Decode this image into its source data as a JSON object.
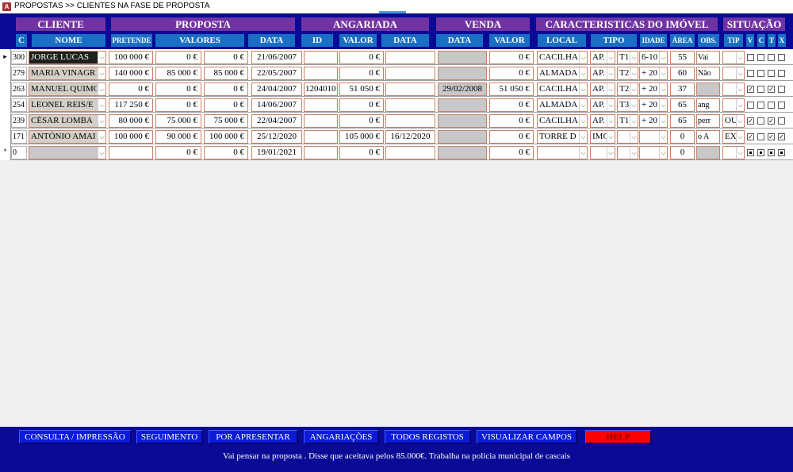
{
  "window": {
    "title": "PROPOSTAS >> CLIENTES NA FASE DE PROPOSTA",
    "icon": "access-icon"
  },
  "groups": {
    "cliente": "CLIENTE",
    "proposta": "PROPOSTA",
    "angariada": "ANGARIADA",
    "venda": "VENDA",
    "caracteristicas": "CARACTERISTICAS DO IMÓVEL",
    "situacao": "SITUAÇÃO"
  },
  "columns": {
    "c": "C",
    "nome": "NOME",
    "pretende": "PRETENDE",
    "valores": "VALORES",
    "data": "DATA",
    "ang_id": "ID",
    "ang_valor": "VALOR",
    "ang_data": "DATA",
    "venda_data": "DATA",
    "venda_valor": "VALOR",
    "local": "LOCAL",
    "tipo": "TIPO",
    "idade": "IDADE",
    "area": "ÁREA",
    "obs": "OBS.",
    "tip": "TIP",
    "v": "V",
    "cc": "C",
    "t": "T",
    "x": "X"
  },
  "rows": [
    {
      "sel": "▸",
      "c": "300",
      "nome": "JORGE LUCAS",
      "pretende": "100 000 €",
      "valor1": "0 €",
      "valor2": "0 €",
      "data": "21/06/2007",
      "ang_id": "",
      "ang_valor": "0 €",
      "ang_data": "",
      "venda_data": "",
      "venda_valor": "0 €",
      "local": "CACILHA",
      "tipo": "AP.",
      "tipo2": "T1",
      "idade": "6-10",
      "area": "55",
      "obs": "Vai",
      "tip": "",
      "v": false,
      "cc": false,
      "t": false,
      "x": false
    },
    {
      "sel": "",
      "c": "279",
      "nome": "MARIA VINAGR",
      "pretende": "140 000 €",
      "valor1": "85 000 €",
      "valor2": "85 000 €",
      "data": "22/05/2007",
      "ang_id": "",
      "ang_valor": "0 €",
      "ang_data": "",
      "venda_data": "",
      "venda_valor": "0 €",
      "local": "ALMADA",
      "tipo": "AP.",
      "tipo2": "T2",
      "idade": "+ 20",
      "area": "60",
      "obs": "Não",
      "tip": "",
      "v": false,
      "cc": false,
      "t": false,
      "x": false
    },
    {
      "sel": "",
      "c": "263",
      "nome": "MANUEL QUIMC",
      "pretende": "0 €",
      "valor1": "0 €",
      "valor2": "0 €",
      "data": "24/04/2007",
      "ang_id": "1204010",
      "ang_valor": "51 050 €",
      "ang_data": "",
      "venda_data": "29/02/2008",
      "venda_valor": "51 050 €",
      "local": "CACILHA",
      "tipo": "AP.",
      "tipo2": "T2",
      "idade": "+ 20",
      "area": "37",
      "obs": "",
      "tip": "",
      "v": true,
      "cc": false,
      "t": true,
      "x": false
    },
    {
      "sel": "",
      "c": "254",
      "nome": "LEONEL REIS/E",
      "pretende": "117 250 €",
      "valor1": "0 €",
      "valor2": "0 €",
      "data": "14/06/2007",
      "ang_id": "",
      "ang_valor": "0 €",
      "ang_data": "",
      "venda_data": "",
      "venda_valor": "0 €",
      "local": "ALMADA",
      "tipo": "AP.",
      "tipo2": "T3",
      "idade": "+ 20",
      "area": "65",
      "obs": "ang",
      "tip": "",
      "v": false,
      "cc": false,
      "t": false,
      "x": false
    },
    {
      "sel": "",
      "c": "239",
      "nome": "CÉSAR LOMBA",
      "pretende": "80 000 €",
      "valor1": "75 000 €",
      "valor2": "75 000 €",
      "data": "22/04/2007",
      "ang_id": "",
      "ang_valor": "0 €",
      "ang_data": "",
      "venda_data": "",
      "venda_valor": "0 €",
      "local": "CACILHA",
      "tipo": "AP.",
      "tipo2": "T1",
      "idade": "+ 20",
      "area": "65",
      "obs": "perr",
      "tip": "OU",
      "v": true,
      "cc": false,
      "t": true,
      "x": false
    },
    {
      "sel": "",
      "c": "171",
      "nome": "ANTÓNIO AMAI",
      "pretende": "100 000 €",
      "valor1": "90 000 €",
      "valor2": "100 000 €",
      "data": "25/12/2020",
      "ang_id": "",
      "ang_valor": "105 000 €",
      "ang_data": "16/12/2020",
      "venda_data": "",
      "venda_valor": "0 €",
      "local": "TORRE D",
      "tipo": "IMC",
      "tipo2": "",
      "idade": "",
      "area": "0",
      "obs": "o A",
      "tip": "EX",
      "v": true,
      "cc": false,
      "t": true,
      "x": true
    },
    {
      "sel": "*",
      "c": "0",
      "nome": "",
      "pretende": "",
      "valor1": "0 €",
      "valor2": "0 €",
      "data": "19/01/2021",
      "ang_id": "",
      "ang_valor": "0 €",
      "ang_data": "",
      "venda_data": "",
      "venda_valor": "0 €",
      "local": "",
      "tipo": "",
      "tipo2": "",
      "idade": "",
      "area": "0",
      "obs": "",
      "tip": "",
      "v": "new",
      "cc": "new",
      "t": "new",
      "x": "new"
    }
  ],
  "footer": {
    "buttons": {
      "consulta": "CONSULTA / IMPRESSÃO",
      "seguimento": "SEGUIMENTO",
      "por_apresentar": "POR APRESENTAR",
      "angariacoes": "ANGARIAÇÕES",
      "todos": "TODOS REGISTOS",
      "visualizar": "VISUALIZAR CAMPOS",
      "help": "HELP"
    },
    "note": "Vai pensar na proposta . Disse que aceitava pelos 85.000€. Trabalha na policia municipal de cascais"
  },
  "colors": {
    "header_bg": "#0a0a96",
    "group_bg": "#7133a3",
    "column_bg": "#1a6fc4",
    "button_bg": "#0b1bd8",
    "help_bg": "#ff0000",
    "cell_border": "#c8826a"
  }
}
